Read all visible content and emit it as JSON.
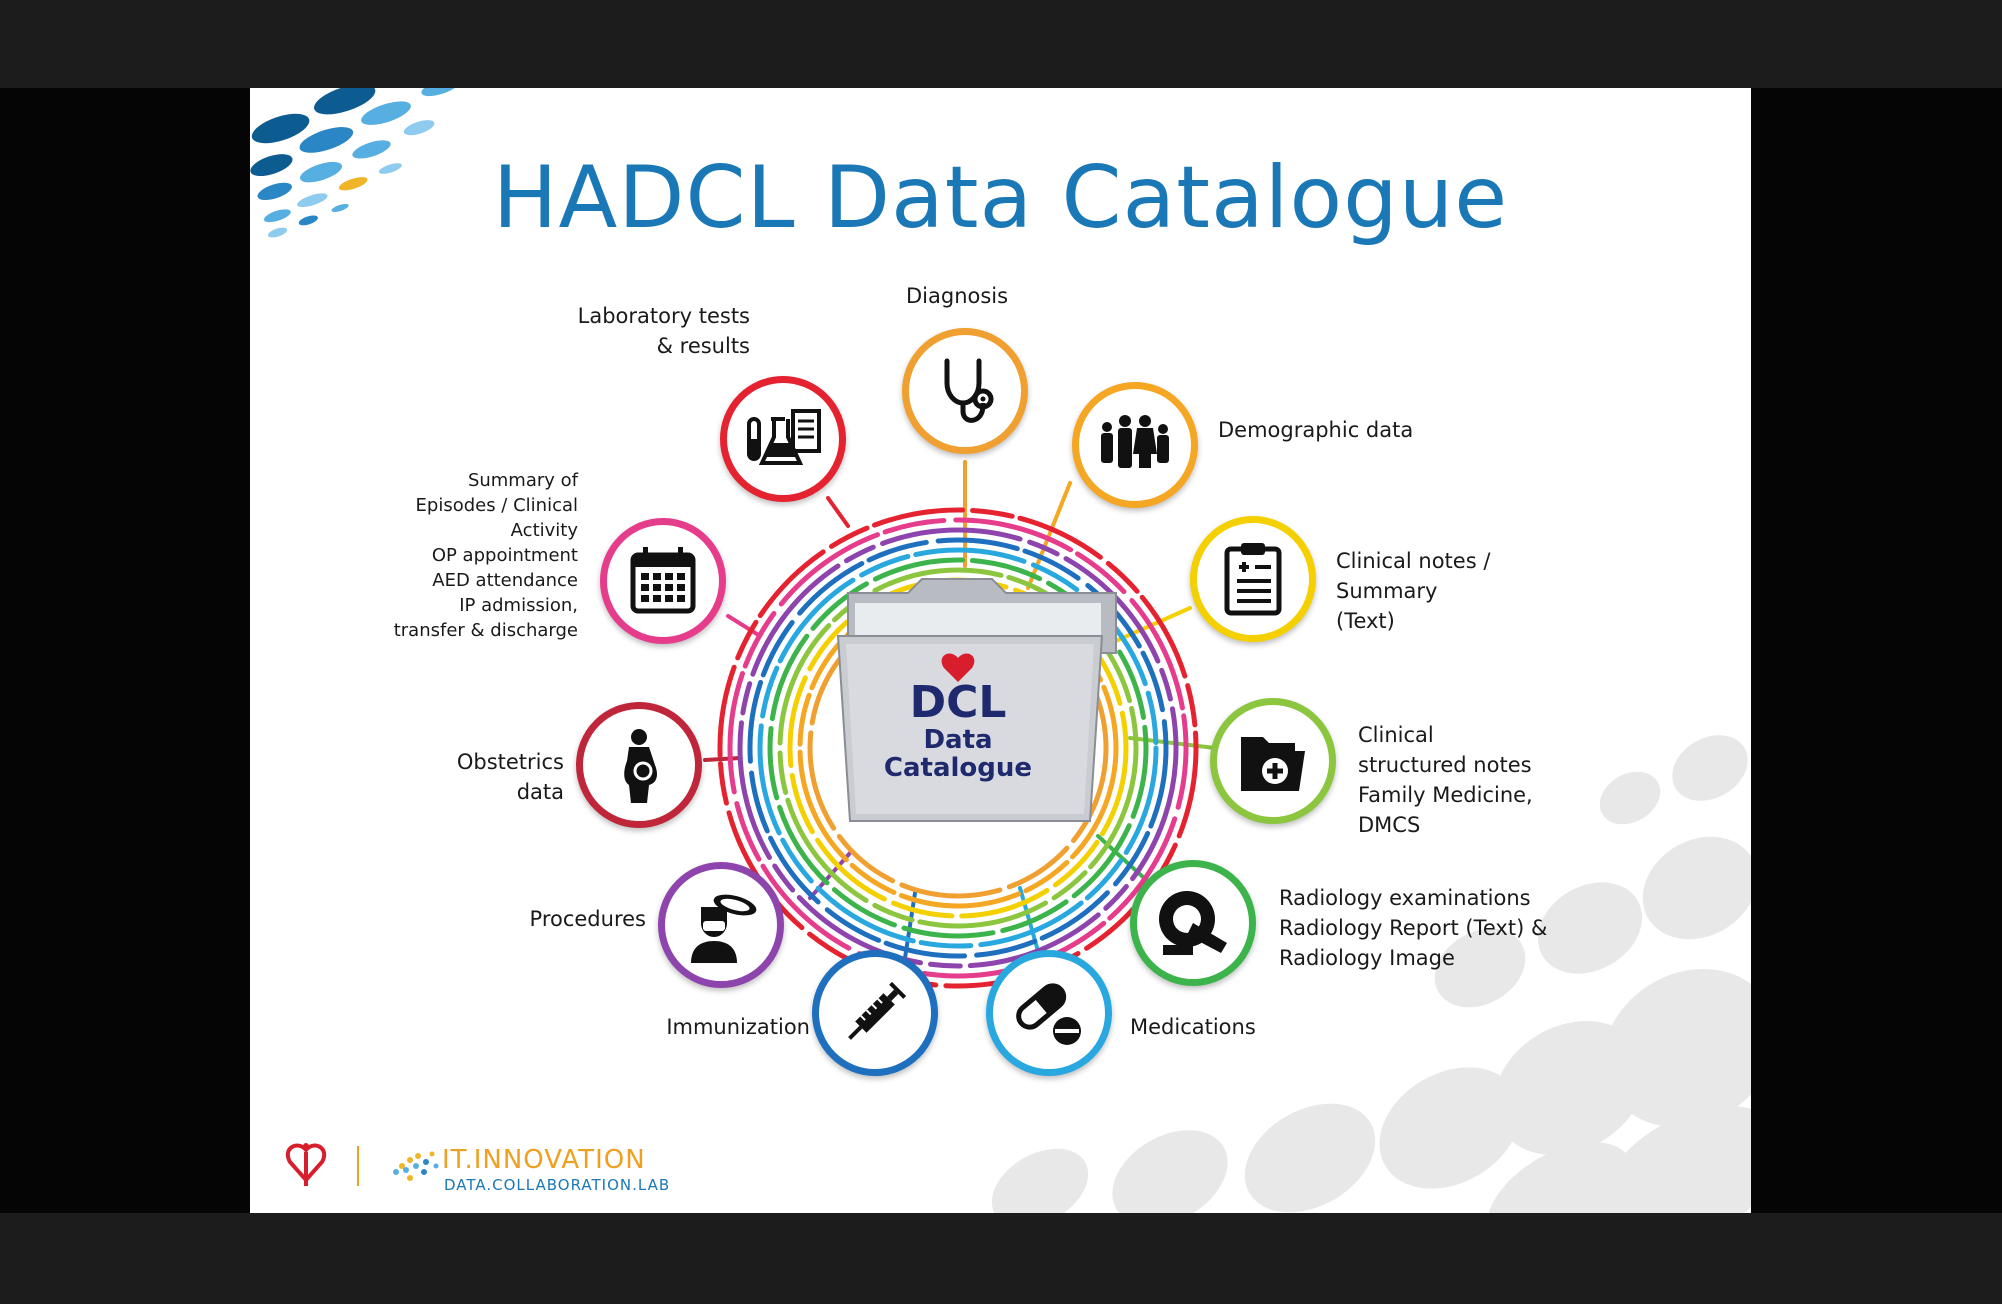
{
  "slide": {
    "title": "HADCL Data Catalogue",
    "hub": {
      "line1": "DCL",
      "line2": "Data",
      "line3": "Catalogue"
    },
    "footer": {
      "org": "IT.INNOVATION",
      "lab": "DATA.COLLABORATION.LAB"
    }
  },
  "categories": {
    "diagnosis": {
      "label": "Diagnosis",
      "icon": "stethoscope-icon",
      "color": "#f0a030"
    },
    "demographic": {
      "label": "Demographic data",
      "icon": "people-icon",
      "color": "#f5a623"
    },
    "clinical_notes": {
      "label": "Clinical notes /\nSummary\n(Text)",
      "icon": "clipboard-icon",
      "color": "#f5d000"
    },
    "structured_notes": {
      "label": "Clinical\nstructured notes\nFamily Medicine,\nDMCS",
      "icon": "medical-folder-icon",
      "color": "#8cc63f"
    },
    "radiology": {
      "label": "Radiology examinations\nRadiology Report (Text) &\nRadiology Image",
      "icon": "ct-scanner-icon",
      "color": "#3cb44b"
    },
    "medications": {
      "label": "Medications",
      "icon": "pill-icon",
      "color": "#29a8e0"
    },
    "immunization": {
      "label": "Immunization",
      "icon": "syringe-icon",
      "color": "#1f6fbf"
    },
    "procedures": {
      "label": "Procedures",
      "icon": "surgeon-icon",
      "color": "#8e44ad"
    },
    "obstetrics": {
      "label": "Obstetrics\ndata",
      "icon": "pregnant-woman-icon",
      "color": "#c0263a"
    },
    "summary": {
      "label": "Summary of\nEpisodes / Clinical\nActivity\nOP appointment\nAED attendance\nIP admission,\ntransfer & discharge",
      "icon": "calendar-icon",
      "color": "#e63c8c"
    },
    "laboratory": {
      "label": "Laboratory tests\n& results",
      "icon": "lab-flask-icon",
      "color": "#e52330"
    }
  }
}
